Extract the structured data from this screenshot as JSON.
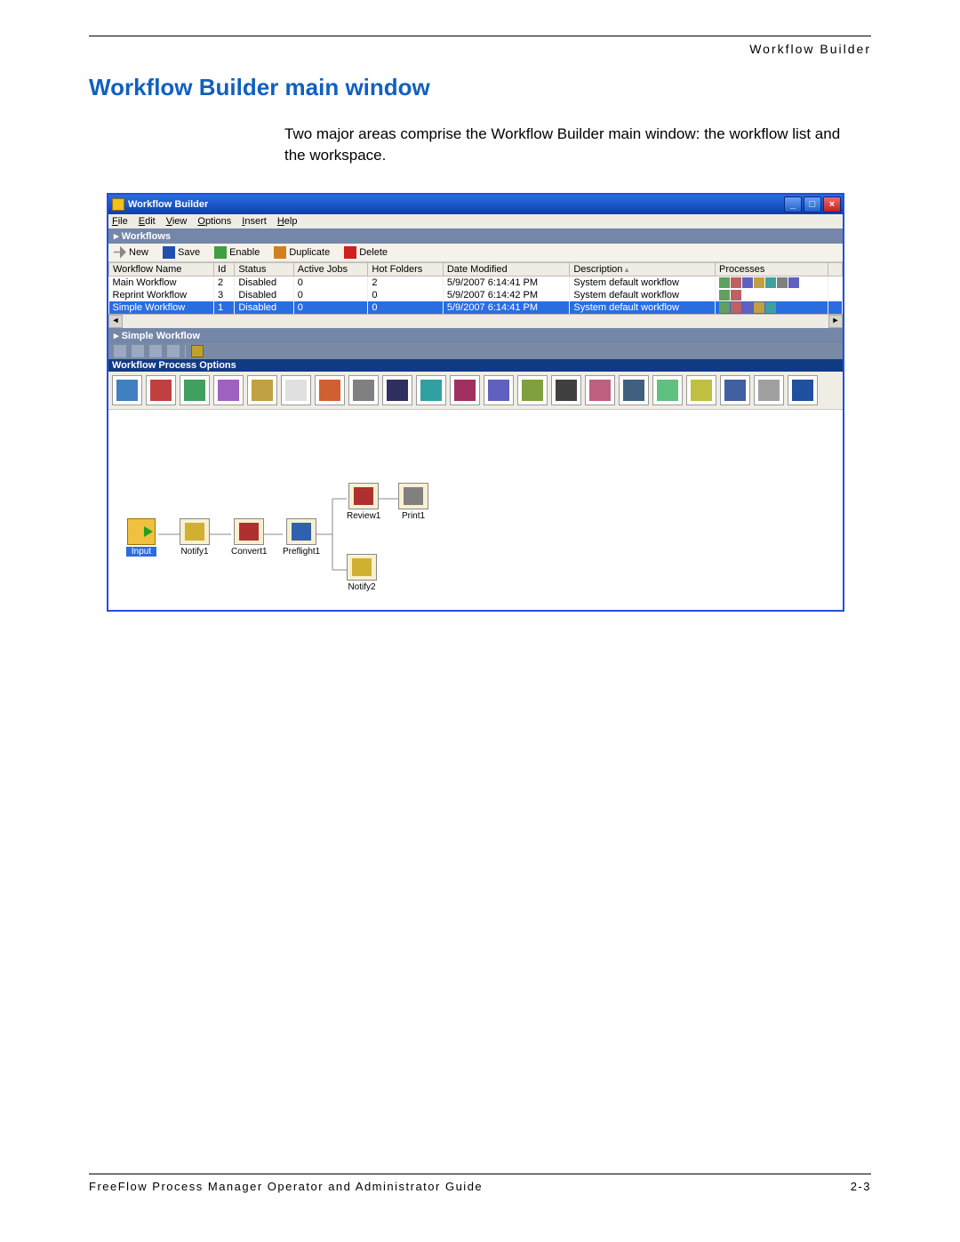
{
  "doc": {
    "running_head": "Workflow Builder",
    "section_title": "Workflow Builder main window",
    "intro": "Two major areas comprise the Workflow Builder main window: the workflow list and the workspace.",
    "footer_left": "FreeFlow Process Manager Operator and Administrator Guide",
    "footer_right": "2-3"
  },
  "app": {
    "title": "Workflow Builder",
    "menu": [
      "File",
      "Edit",
      "View",
      "Options",
      "Insert",
      "Help"
    ],
    "panel_workflows": "Workflows",
    "toolbar": {
      "new": "New",
      "save": "Save",
      "enable": "Enable",
      "duplicate": "Duplicate",
      "delete": "Delete"
    },
    "columns": [
      "Workflow Name",
      "Id",
      "Status",
      "Active Jobs",
      "Hot Folders",
      "Date Modified",
      "Description",
      "Processes"
    ],
    "rows": [
      {
        "name": "Main Workflow",
        "id": "2",
        "status": "Disabled",
        "active": "0",
        "hot": "2",
        "date": "5/9/2007 6:14:41 PM",
        "desc": "System default workflow",
        "selected": false,
        "icons": 7
      },
      {
        "name": "Reprint Workflow",
        "id": "3",
        "status": "Disabled",
        "active": "0",
        "hot": "0",
        "date": "5/9/2007 6:14:42 PM",
        "desc": "System default workflow",
        "selected": false,
        "icons": 2
      },
      {
        "name": "Simple Workflow",
        "id": "1",
        "status": "Disabled",
        "active": "0",
        "hot": "0",
        "date": "5/9/2007 6:14:41 PM",
        "desc": "System default workflow",
        "selected": true,
        "icons": 5
      }
    ],
    "panel_current": "Simple Workflow",
    "opts_header": "Workflow Process Options",
    "nodes": {
      "input": "Input",
      "notify1": "Notify1",
      "convert1": "Convert1",
      "preflight1": "Preflight1",
      "review1": "Review1",
      "print1": "Print1",
      "notify2": "Notify2"
    }
  }
}
